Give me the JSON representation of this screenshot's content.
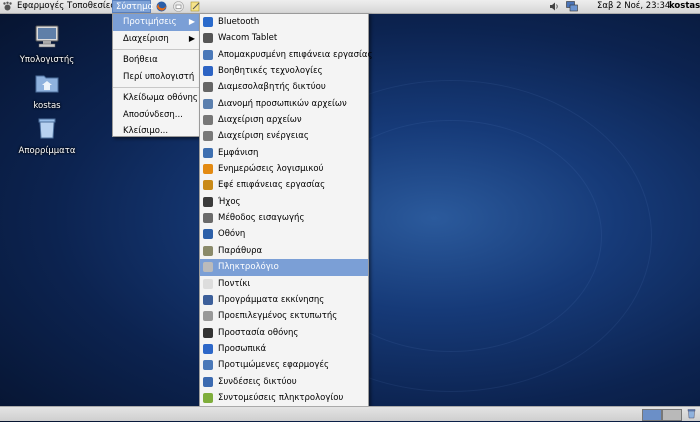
{
  "top_panel": {
    "menus": {
      "applications": "Εφαρμογές",
      "places": "Τοποθεσίες",
      "system": "Σύστημα"
    },
    "launchers": [
      "firefox-icon",
      "mail-icon",
      "note-icon"
    ],
    "clock": "Σαβ  2 Νοέ, 23:34",
    "user": "kostas",
    "tray": [
      "volume-icon",
      "network-icon"
    ]
  },
  "desktop": {
    "icons": [
      {
        "label": "Υπολογιστής",
        "icon": "computer-icon"
      },
      {
        "label": "kostas",
        "icon": "home-folder-icon"
      },
      {
        "label": "Απορρίμματα",
        "icon": "trash-icon"
      }
    ]
  },
  "system_menu": {
    "items": [
      {
        "label": "Προτιμήσεις",
        "submenu": true,
        "selected": true
      },
      {
        "label": "Διαχείριση",
        "submenu": true,
        "selected": false
      },
      {
        "label": "Βοήθεια"
      },
      {
        "label": "Περί υπολογιστή"
      },
      {
        "label": "Κλείδωμα οθόνης"
      },
      {
        "label": "Αποσύνδεση..."
      },
      {
        "label": "Κλείσιμο..."
      }
    ]
  },
  "preferences_menu": {
    "items": [
      {
        "label": "Bluetooth",
        "color": "#2a6acb"
      },
      {
        "label": "Wacom Tablet",
        "color": "#555555"
      },
      {
        "label": "Απομακρυσμένη επιφάνεια εργασίας",
        "color": "#4a78b8"
      },
      {
        "label": "Βοηθητικές τεχνολογίες",
        "color": "#2d64c4"
      },
      {
        "label": "Διαμεσολαβητής δικτύου",
        "color": "#666666"
      },
      {
        "label": "Διανομή προσωπικών αρχείων",
        "color": "#5b7fae"
      },
      {
        "label": "Διαχείριση αρχείων",
        "color": "#777777"
      },
      {
        "label": "Διαχείριση ενέργειας",
        "color": "#7a7a7a"
      },
      {
        "label": "Εμφάνιση",
        "color": "#3e6fb0"
      },
      {
        "label": "Ενημερώσεις λογισμικού",
        "color": "#e38a12"
      },
      {
        "label": "Εφέ επιφάνειας εργασίας",
        "color": "#c98a18"
      },
      {
        "label": "Ήχος",
        "color": "#3a3a3a"
      },
      {
        "label": "Μέθοδος εισαγωγής",
        "color": "#6a6a6a"
      },
      {
        "label": "Οθόνη",
        "color": "#2c5fa8"
      },
      {
        "label": "Παράθυρα",
        "color": "#8a8a6a"
      },
      {
        "label": "Πληκτρολόγιο",
        "color": "#bbbbbb",
        "selected": true
      },
      {
        "label": "Ποντίκι",
        "color": "#dddddd"
      },
      {
        "label": "Προγράμματα εκκίνησης",
        "color": "#3c5f9a"
      },
      {
        "label": "Προεπιλεγμένος εκτυπωτής",
        "color": "#999999"
      },
      {
        "label": "Προστασία οθόνης",
        "color": "#333333"
      },
      {
        "label": "Προσωπικά",
        "color": "#2d67c8"
      },
      {
        "label": "Προτιμώμενες εφαρμογές",
        "color": "#4a78b8"
      },
      {
        "label": "Συνδέσεις δικτύου",
        "color": "#3b6ab0"
      },
      {
        "label": "Συντομεύσεις πληκτρολογίου",
        "color": "#7fae3c"
      }
    ]
  },
  "bottom_panel": {
    "workspaces": [
      "workspace-1",
      "workspace-2"
    ]
  }
}
